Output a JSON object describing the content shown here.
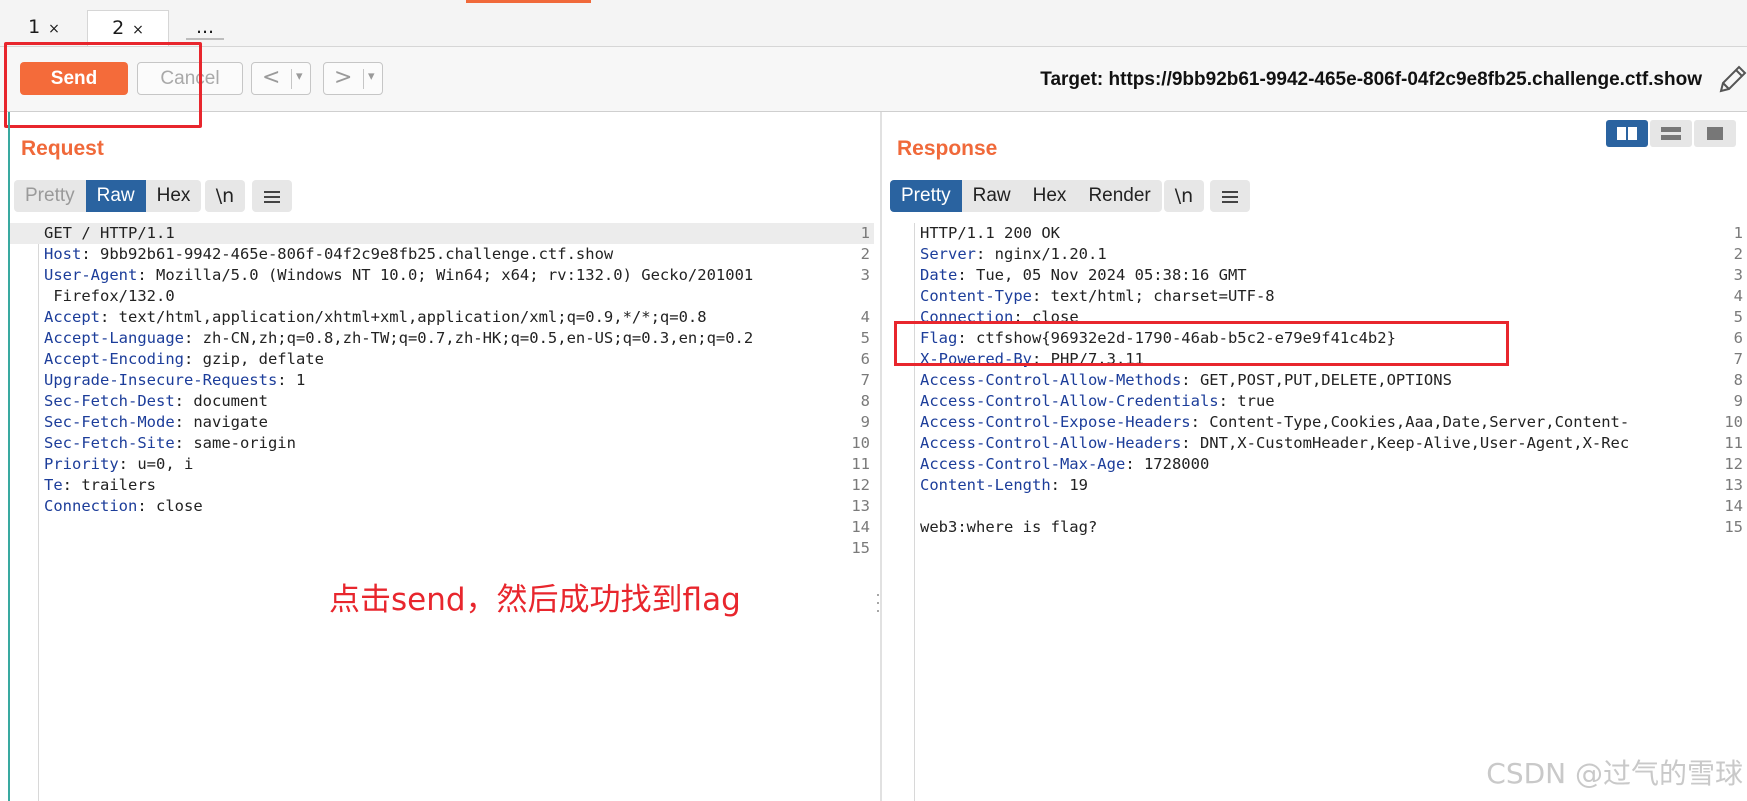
{
  "tabs": [
    {
      "label": "1",
      "close": "×"
    },
    {
      "label": "2",
      "close": "×"
    },
    {
      "label": "..."
    }
  ],
  "toolbar": {
    "send_label": "Send",
    "cancel_label": "Cancel",
    "back_glyph": "<",
    "forward_glyph": ">",
    "caret_glyph": "▾",
    "target": "Target: https://9bb92b61-9942-465e-806f-04f2c9e8fb25.challenge.ctf.show"
  },
  "request": {
    "title": "Request",
    "view_tabs": [
      "Pretty",
      "Raw",
      "Hex"
    ],
    "active_view": "Raw",
    "newline_label": "\\n",
    "lines": [
      {
        "n": "1",
        "key": "",
        "text": "GET / HTTP/1.1"
      },
      {
        "n": "2",
        "key": "Host",
        "text": ": 9bb92b61-9942-465e-806f-04f2c9e8fb25.challenge.ctf.show"
      },
      {
        "n": "3",
        "key": "User-Agent",
        "text": ": Mozilla/5.0 (Windows NT 10.0; Win64; x64; rv:132.0) Gecko/201001"
      },
      {
        "n": "",
        "key": "",
        "text": " Firefox/132.0"
      },
      {
        "n": "4",
        "key": "Accept",
        "text": ": text/html,application/xhtml+xml,application/xml;q=0.9,*/*;q=0.8"
      },
      {
        "n": "5",
        "key": "Accept-Language",
        "text": ": zh-CN,zh;q=0.8,zh-TW;q=0.7,zh-HK;q=0.5,en-US;q=0.3,en;q=0.2"
      },
      {
        "n": "6",
        "key": "Accept-Encoding",
        "text": ": gzip, deflate"
      },
      {
        "n": "7",
        "key": "Upgrade-Insecure-Requests",
        "text": ": 1"
      },
      {
        "n": "8",
        "key": "Sec-Fetch-Dest",
        "text": ": document"
      },
      {
        "n": "9",
        "key": "Sec-Fetch-Mode",
        "text": ": navigate"
      },
      {
        "n": "10",
        "key": "Sec-Fetch-Site",
        "text": ": same-origin"
      },
      {
        "n": "11",
        "key": "Priority",
        "text": ": u=0, i"
      },
      {
        "n": "12",
        "key": "Te",
        "text": ": trailers"
      },
      {
        "n": "13",
        "key": "Connection",
        "text": ": close"
      },
      {
        "n": "14",
        "key": "",
        "text": ""
      },
      {
        "n": "15",
        "key": "",
        "text": ""
      }
    ]
  },
  "response": {
    "title": "Response",
    "view_tabs": [
      "Pretty",
      "Raw",
      "Hex",
      "Render"
    ],
    "active_view": "Pretty",
    "newline_label": "\\n",
    "lines": [
      {
        "n": "1",
        "key": "",
        "text": "HTTP/1.1 200 OK"
      },
      {
        "n": "2",
        "key": "Server",
        "text": ": nginx/1.20.1"
      },
      {
        "n": "3",
        "key": "Date",
        "text": ": Tue, 05 Nov 2024 05:38:16 GMT"
      },
      {
        "n": "4",
        "key": "Content-Type",
        "text": ": text/html; charset=UTF-8"
      },
      {
        "n": "5",
        "key": "Connection",
        "text": ": close"
      },
      {
        "n": "6",
        "key": "Flag",
        "text": ": ctfshow{96932e2d-1790-46ab-b5c2-e79e9f41c4b2}"
      },
      {
        "n": "7",
        "key": "X-Powered-By",
        "text": ": PHP/7.3.11"
      },
      {
        "n": "8",
        "key": "Access-Control-Allow-Methods",
        "text": ": GET,POST,PUT,DELETE,OPTIONS"
      },
      {
        "n": "9",
        "key": "Access-Control-Allow-Credentials",
        "text": ": true"
      },
      {
        "n": "10",
        "key": "Access-Control-Expose-Headers",
        "text": ": Content-Type,Cookies,Aaa,Date,Server,Content-"
      },
      {
        "n": "11",
        "key": "Access-Control-Allow-Headers",
        "text": ": DNT,X-CustomHeader,Keep-Alive,User-Agent,X-Rec"
      },
      {
        "n": "12",
        "key": "Access-Control-Max-Age",
        "text": ": 1728000"
      },
      {
        "n": "13",
        "key": "Content-Length",
        "text": ": 19"
      },
      {
        "n": "14",
        "key": "",
        "text": ""
      },
      {
        "n": "15",
        "key": "",
        "text": "web3:where is flag?"
      }
    ]
  },
  "annotation": "点击send，然后成功找到flag",
  "watermark": "CSDN @过气的雪球",
  "colors": {
    "accent": "#f0693a",
    "send_button": "#f46b3a",
    "active_tab": "#2a63a0",
    "header_key": "#1c3d9a",
    "annotation_red": "#e8262d"
  }
}
